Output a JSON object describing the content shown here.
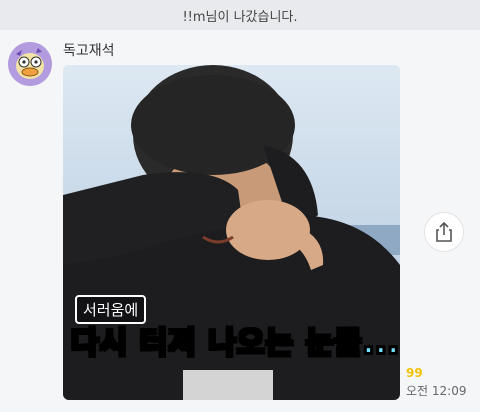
{
  "notice": {
    "text": "!!m님이 나갔습니다."
  },
  "message": {
    "sender": "독고재석",
    "caption_small": "서러움에",
    "caption_big_1": "다시 ",
    "caption_big_2": "터져 ",
    "caption_big_3": "나오는 ",
    "caption_big_4": "눈물...",
    "unread": "99",
    "time": "오전 12:09"
  },
  "colors": {
    "caption_white": "#ffffff",
    "caption_orange": "#ff7a2b",
    "caption_cyan": "#6fe3ff",
    "unread_yellow": "#f2c200"
  },
  "icons": {
    "share": "share-icon"
  }
}
